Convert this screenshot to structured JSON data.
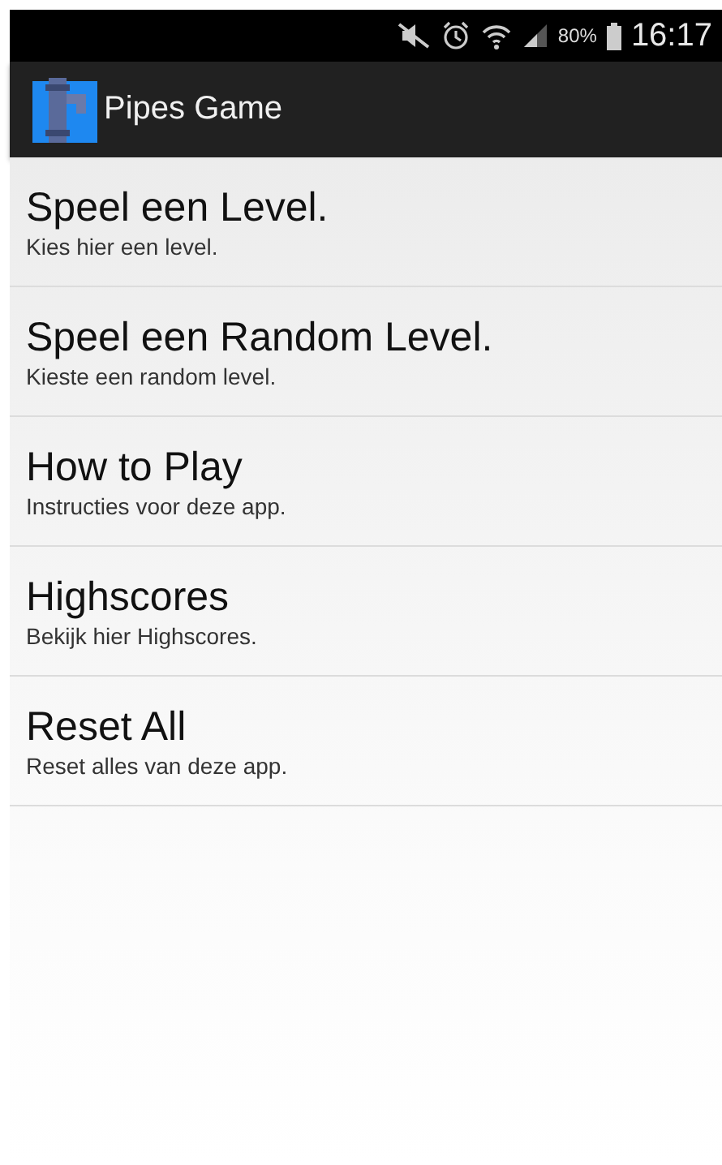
{
  "status_bar": {
    "battery_text": "80%",
    "time": "16:17"
  },
  "app_bar": {
    "title": "Pipes Game"
  },
  "menu": [
    {
      "title": "Speel een Level.",
      "subtitle": "Kies hier een level."
    },
    {
      "title": "Speel een Random Level.",
      "subtitle": "Kieste een random level."
    },
    {
      "title": "How to Play",
      "subtitle": "Instructies voor deze app."
    },
    {
      "title": "Highscores",
      "subtitle": "Bekijk hier Highscores."
    },
    {
      "title": "Reset All",
      "subtitle": "Reset alles van deze app."
    }
  ]
}
